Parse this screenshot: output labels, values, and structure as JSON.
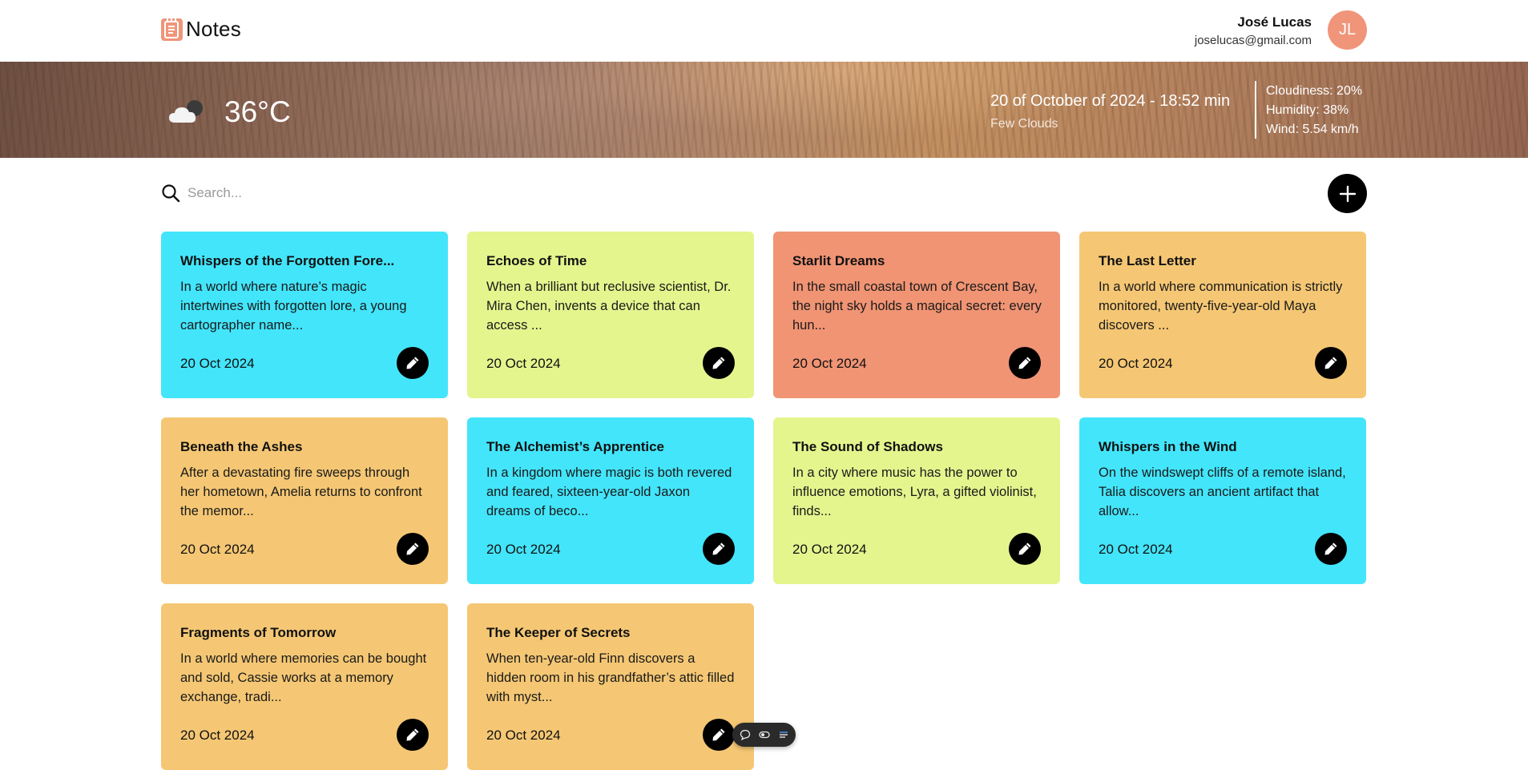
{
  "app": {
    "title": "Notes"
  },
  "user": {
    "name": "José Lucas",
    "email": "joselucas@gmail.com",
    "initials": "JL"
  },
  "weather": {
    "temperature": "36°C",
    "datetime": "20 of October of 2024 - 18:52 min",
    "condition": "Few Clouds",
    "cloudiness": "Cloudiness: 20%",
    "humidity": "Humidity: 38%",
    "wind": "Wind: 5.54 km/h",
    "icon": "cloud-moon-icon"
  },
  "search": {
    "placeholder": "Search..."
  },
  "colors": {
    "cyan": "#43e5fa",
    "lime": "#e4f58e",
    "salmon": "#f09474",
    "orange": "#f5c774"
  },
  "notes": [
    {
      "title": "Whispers of the Forgotten Fore...",
      "body": "In a world where nature’s magic intertwines with forgotten lore, a young cartographer name...",
      "date": "20 Oct 2024",
      "color": "#43e5fa"
    },
    {
      "title": "Echoes of Time",
      "body": "When a brilliant but reclusive scientist, Dr. Mira Chen, invents a device that can access ...",
      "date": "20 Oct 2024",
      "color": "#e4f58e"
    },
    {
      "title": "Starlit Dreams",
      "body": "In the small coastal town of Crescent Bay, the night sky holds a magical secret: every hun...",
      "date": "20 Oct 2024",
      "color": "#f09474"
    },
    {
      "title": "The Last Letter",
      "body": "In a world where communication is strictly monitored, twenty-five-year-old Maya discovers ...",
      "date": "20 Oct 2024",
      "color": "#f5c774"
    },
    {
      "title": "Beneath the Ashes",
      "body": "After a devastating fire sweeps through her hometown, Amelia returns to confront the memor...",
      "date": "20 Oct 2024",
      "color": "#f5c774"
    },
    {
      "title": "The Alchemist’s Apprentice",
      "body": "In a kingdom where magic is both revered and feared, sixteen-year-old Jaxon dreams of beco...",
      "date": "20 Oct 2024",
      "color": "#43e5fa"
    },
    {
      "title": "The Sound of Shadows",
      "body": "In a city where music has the power to influence emotions, Lyra, a gifted violinist, finds...",
      "date": "20 Oct 2024",
      "color": "#e4f58e"
    },
    {
      "title": "Whispers in the Wind",
      "body": "On the windswept cliffs of a remote island, Talia discovers an ancient artifact that allow...",
      "date": "20 Oct 2024",
      "color": "#43e5fa"
    },
    {
      "title": "Fragments of Tomorrow",
      "body": "In a world where memories can be bought and sold, Cassie works at a memory exchange, tradi...",
      "date": "20 Oct 2024",
      "color": "#f5c774"
    },
    {
      "title": "The Keeper of Secrets",
      "body": "When ten-year-old Finn discovers a hidden room in his grandfather’s attic filled with myst...",
      "date": "20 Oct 2024",
      "color": "#f5c774"
    }
  ]
}
